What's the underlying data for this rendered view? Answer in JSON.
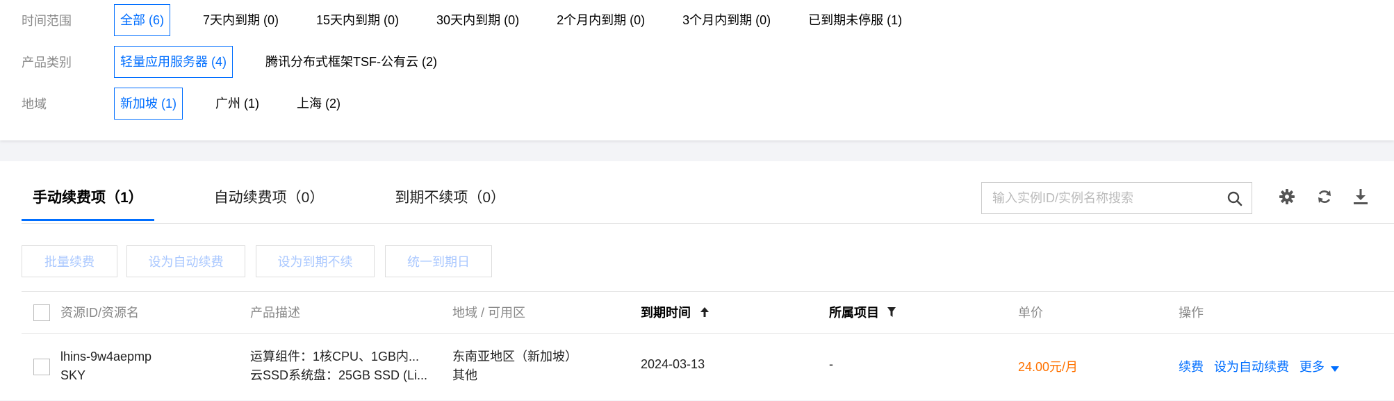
{
  "filters": [
    {
      "label": "时间范围",
      "options": [
        {
          "text": "全部 (6)",
          "selected": true
        },
        {
          "text": "7天内到期 (0)"
        },
        {
          "text": "15天内到期 (0)"
        },
        {
          "text": "30天内到期 (0)"
        },
        {
          "text": "2个月内到期 (0)"
        },
        {
          "text": "3个月内到期 (0)"
        },
        {
          "text": "已到期未停服 (1)"
        }
      ]
    },
    {
      "label": "产品类别",
      "options": [
        {
          "text": "轻量应用服务器 (4)",
          "selected": true
        },
        {
          "text": "腾讯分布式框架TSF-公有云 (2)"
        }
      ]
    },
    {
      "label": "地域",
      "options": [
        {
          "text": "新加坡 (1)",
          "selected": true
        },
        {
          "text": "广州 (1)"
        },
        {
          "text": "上海 (2)"
        }
      ]
    }
  ],
  "tabs": [
    {
      "label": "手动续费项（1）",
      "active": true
    },
    {
      "label": "自动续费项（0）"
    },
    {
      "label": "到期不续项（0）"
    }
  ],
  "search": {
    "placeholder": "输入实例ID/实例名称搜索"
  },
  "toolbar_icons": [
    "gear-icon",
    "refresh-icon",
    "download-icon"
  ],
  "actions": {
    "batch_renew": "批量续费",
    "set_auto_renew": "设为自动续费",
    "set_no_renew": "设为到期不续",
    "unify_due_date": "统一到期日"
  },
  "table": {
    "headers": {
      "resource": "资源ID/资源名",
      "product": "产品描述",
      "region": "地域 / 可用区",
      "due_time": "到期时间",
      "project": "所属项目",
      "price": "单价",
      "ops": "操作"
    },
    "rows": [
      {
        "resource_id": "lhins-9w4aepmp",
        "resource_name": "SKY",
        "product_line1": "运算组件：1核CPU、1GB内...",
        "product_line2": "云SSD系统盘：25GB SSD (Li...",
        "region": "东南亚地区（新加坡）",
        "zone": "其他",
        "due_time": "2024-03-13",
        "project": "-",
        "price": "24.00元/月",
        "op_renew": "续费",
        "op_auto": "设为自动续费",
        "op_more": "更多"
      }
    ]
  },
  "colors": {
    "accent": "#006eff",
    "price": "#ff7200"
  }
}
